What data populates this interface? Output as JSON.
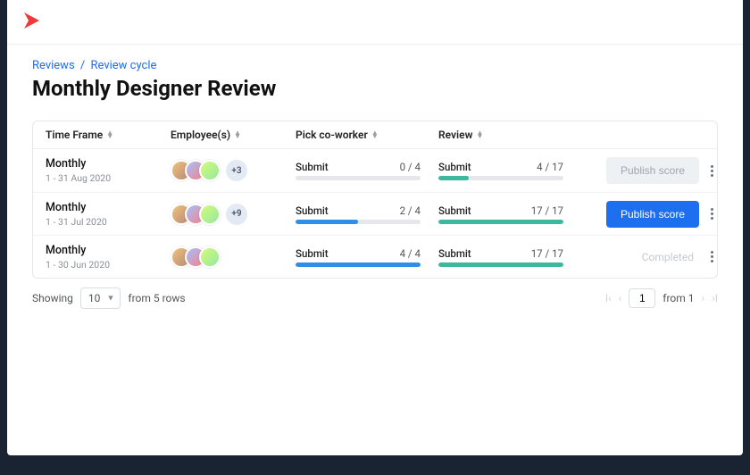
{
  "breadcrumb": {
    "reviews": "Reviews",
    "cycle": "Review cycle"
  },
  "page_title": "Monthly Designer Review",
  "columns": {
    "time_frame": "Time Frame",
    "employees": "Employee(s)",
    "pick_coworker": "Pick co-worker",
    "review": "Review"
  },
  "rows": [
    {
      "period": "Monthly",
      "range": "1 - 31 Aug 2020",
      "extra": "+3",
      "pick": {
        "label": "Submit",
        "done": 0,
        "total": 4,
        "pct": 0
      },
      "review": {
        "label": "Submit",
        "done": 4,
        "total": 17,
        "pct": 24
      },
      "action": {
        "label": "Publish score",
        "state": "disabled"
      }
    },
    {
      "period": "Monthly",
      "range": "1 - 31 Jul 2020",
      "extra": "+9",
      "pick": {
        "label": "Submit",
        "done": 2,
        "total": 4,
        "pct": 50
      },
      "review": {
        "label": "Submit",
        "done": 17,
        "total": 17,
        "pct": 100
      },
      "action": {
        "label": "Publish score",
        "state": "primary"
      }
    },
    {
      "period": "Monthly",
      "range": "1 - 30 Jun 2020",
      "extra": "",
      "pick": {
        "label": "Submit",
        "done": 4,
        "total": 4,
        "pct": 100
      },
      "review": {
        "label": "Submit",
        "done": 17,
        "total": 17,
        "pct": 100
      },
      "action": {
        "label": "Completed",
        "state": "completed"
      }
    }
  ],
  "pagination": {
    "showing": "Showing",
    "page_size": "10",
    "from_rows": "from 5 rows",
    "page": "1",
    "from_total": "from 1"
  }
}
